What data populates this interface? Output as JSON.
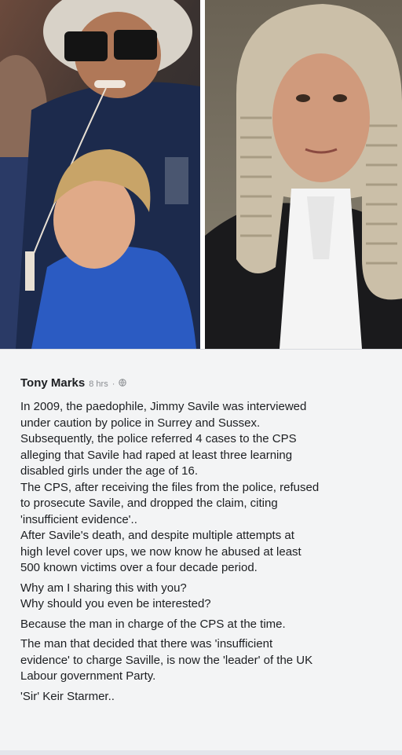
{
  "post": {
    "author": "Tony Marks",
    "time": "8 hrs",
    "separator": "·",
    "paragraphs": [
      "In 2009, the paedophile, Jimmy Savile was interviewed\nunder caution by police in Surrey and Sussex.\nSubsequently, the police referred 4 cases to the CPS\nalleging that Savile had raped at least three learning\ndisabled girls under the age of 16.\nThe CPS, after receiving the files from the police, refused\nto prosecute Savile, and dropped the claim, citing\n'insufficient evidence'..\nAfter Savile's death, and despite multiple attempts at\nhigh level cover ups, we now know he abused at least\n500 known victims over a four decade period.",
      "Why am I sharing this with you?\nWhy should you even be interested?",
      "Because the man in charge of the CPS at the time.",
      "The man that decided that there was 'insufficient\nevidence' to charge Saville, is now the 'leader' of the UK\nLabour government Party.",
      "'Sir' Keir Starmer.."
    ]
  },
  "icons": {
    "privacy": "globe-icon"
  }
}
